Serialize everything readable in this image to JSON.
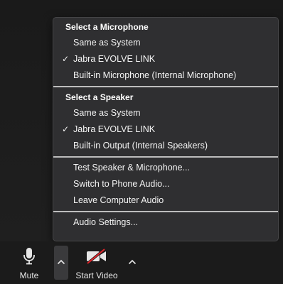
{
  "microphone_section": {
    "header": "Select a Microphone",
    "items": [
      {
        "label": "Same as System",
        "checked": false
      },
      {
        "label": "Jabra EVOLVE LINK",
        "checked": true
      },
      {
        "label": "Built-in Microphone (Internal Microphone)",
        "checked": false
      }
    ]
  },
  "speaker_section": {
    "header": "Select a Speaker",
    "items": [
      {
        "label": "Same as System",
        "checked": false
      },
      {
        "label": "Jabra EVOLVE LINK",
        "checked": true
      },
      {
        "label": "Built-in Output (Internal Speakers)",
        "checked": false
      }
    ]
  },
  "actions": {
    "items": [
      {
        "label": "Test Speaker & Microphone..."
      },
      {
        "label": "Switch to Phone Audio..."
      },
      {
        "label": "Leave Computer Audio"
      }
    ]
  },
  "settings": {
    "label": "Audio Settings..."
  },
  "check_glyph": "✓",
  "toolbar": {
    "mute_label": "Mute",
    "video_label": "Start Video",
    "mute_icon": "microphone-icon",
    "video_icon": "video-camera-off-icon"
  }
}
